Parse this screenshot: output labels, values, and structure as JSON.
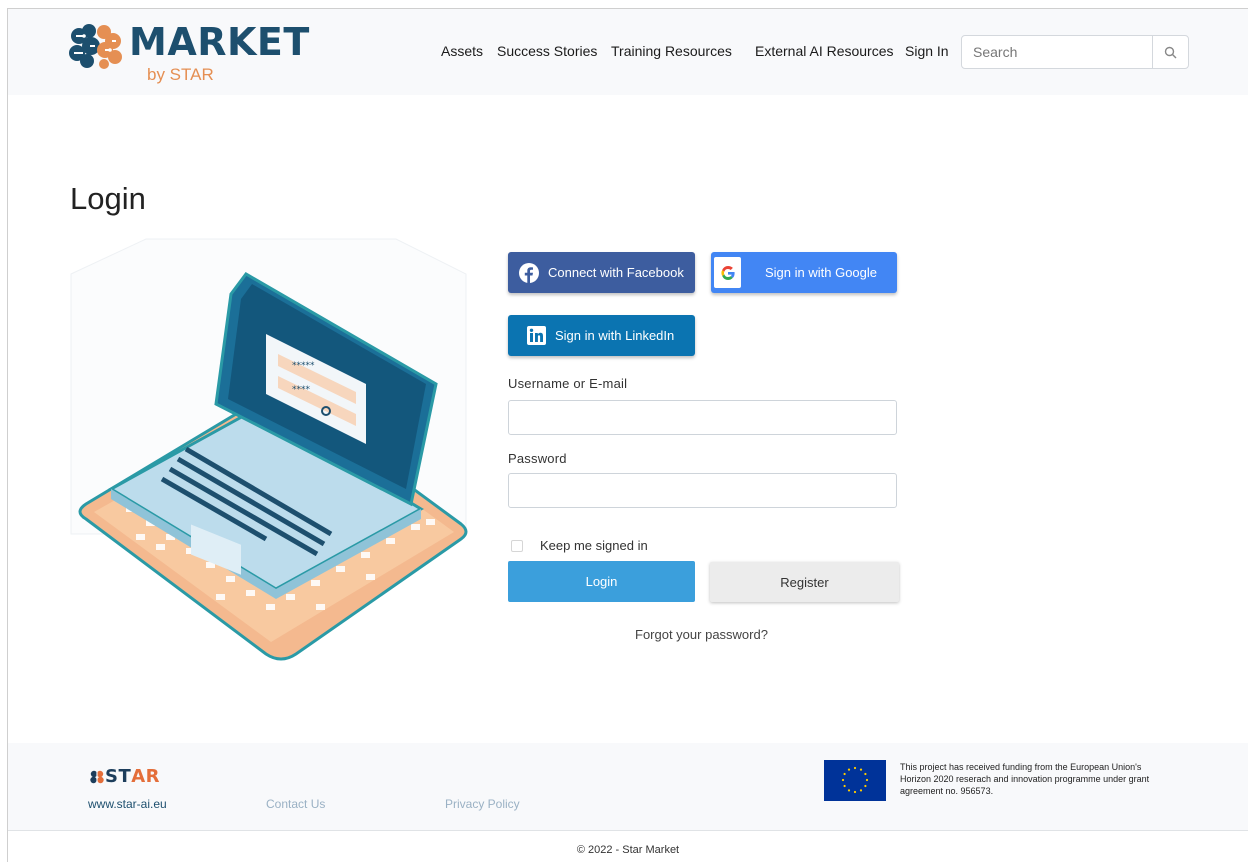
{
  "header": {
    "logo_title": "MARKET",
    "logo_subtitle": "by STAR",
    "nav": {
      "assets": "Assets",
      "success": "Success Stories",
      "training": "Training Resources",
      "external": "External AI Resources",
      "signin": "Sign In"
    },
    "search": {
      "placeholder": "Search",
      "value": ""
    }
  },
  "main": {
    "title": "Login",
    "social": {
      "facebook": "Connect with Facebook",
      "google": "Sign in with Google",
      "linkedin": "Sign in with LinkedIn"
    },
    "form": {
      "username_label": "Username or E-mail",
      "username_value": "",
      "password_label": "Password",
      "password_value": "",
      "keep_signed_in": "Keep me signed in",
      "keep_signed_in_checked": false,
      "login_button": "Login",
      "register_button": "Register",
      "forgot": "Forgot your password?"
    }
  },
  "footer": {
    "star_logo_left": "ST",
    "star_logo_right": "AR",
    "star_link": "www.star-ai.eu",
    "contact": "Contact Us",
    "privacy": "Privacy Policy",
    "funding_text": "This project has received funding from the European Union's Horizon 2020 reserach and innovation programme under grant agreement no. 956573.",
    "copyright": "© 2022 - Star Market"
  },
  "colors": {
    "brand_dark": "#1d4f6e",
    "brand_orange": "#e58f53",
    "facebook": "#3d5d9f",
    "google": "#4286f4",
    "linkedin": "#0b74b1",
    "login": "#3b9fdc"
  }
}
